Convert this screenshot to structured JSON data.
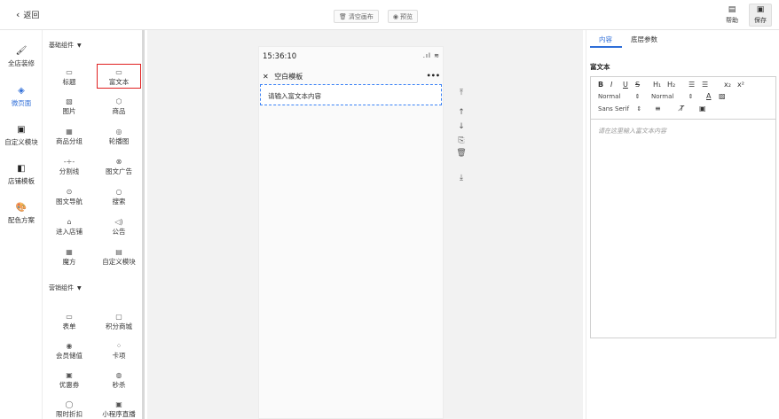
{
  "topbar": {
    "back_label": "返回",
    "clear_label": "清空画布",
    "preview_label": "预览",
    "help_label": "帮助",
    "save_label": "保存"
  },
  "leftnav": [
    {
      "label": "全店装修",
      "icon": "paint-roller-icon"
    },
    {
      "label": "微页面",
      "icon": "layers-icon",
      "active": true
    },
    {
      "label": "自定义模块",
      "icon": "module-icon"
    },
    {
      "label": "店铺模板",
      "icon": "template-icon"
    },
    {
      "label": "配色方案",
      "icon": "palette-icon"
    }
  ],
  "panel": {
    "basic_title": "基础组件",
    "basic": [
      "标题",
      "富文本",
      "图片",
      "商品",
      "商品分组",
      "轮播图",
      "分割线",
      "图文广告",
      "图文导航",
      "搜索",
      "进入店铺",
      "公告",
      "魔方",
      "自定义模块"
    ],
    "marketing_title": "营销组件",
    "marketing": [
      "表单",
      "积分商城",
      "会员储值",
      "卡项",
      "优惠券",
      "秒杀",
      "限时折扣",
      "小程序直播"
    ],
    "selected": "富文本"
  },
  "phone": {
    "time": "15:36:10",
    "title": "空白模板",
    "more": "•••",
    "rich_text_placeholder": "请输入富文本内容"
  },
  "rpanel": {
    "tab_content": "内容",
    "tab_layer": "底层参数",
    "section_label": "富文本",
    "editor": {
      "bold": "B",
      "italic": "I",
      "underline": "U",
      "strike": "S",
      "h1": "H₁",
      "h2": "H₂",
      "sub": "x₂",
      "sup": "x²",
      "size": "Normal",
      "header": "Normal",
      "font": "Sans Serif",
      "placeholder": "请在这里输入富文本内容"
    }
  }
}
